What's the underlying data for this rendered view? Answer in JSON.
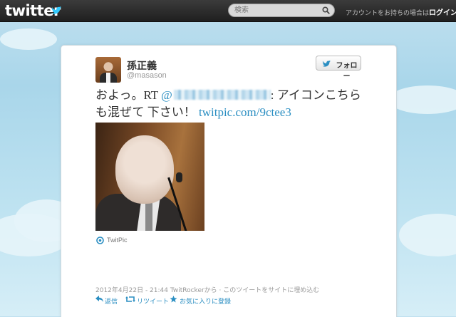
{
  "header": {
    "logo_text": "twitter",
    "search": {
      "placeholder": "検索"
    },
    "login_prompt": "アカウントをお持ちの場合は",
    "login_link": "ログイン"
  },
  "tweet": {
    "author_name": "孫正義",
    "author_handle": "@masason",
    "follow_label": "フォロー",
    "text_prefix": "およっ。RT ",
    "mention_prefix": "@",
    "text_middle": ": アイコンこちらも混ぜて 下さい！ ",
    "link": "twitpic.com/9ctee3",
    "media_source": "TwitPic",
    "timestamp": "2012年4月22日 - 21:44 TwitRockerから",
    "embed_link": "このツイートをサイトに埋め込む",
    "actions": {
      "reply": "返信",
      "retweet": "リツイート",
      "favorite": "お気に入りに登録"
    }
  },
  "colors": {
    "link": "#2a8ec2",
    "topbar": "#2b2b2b",
    "background": "#b3dbee"
  }
}
